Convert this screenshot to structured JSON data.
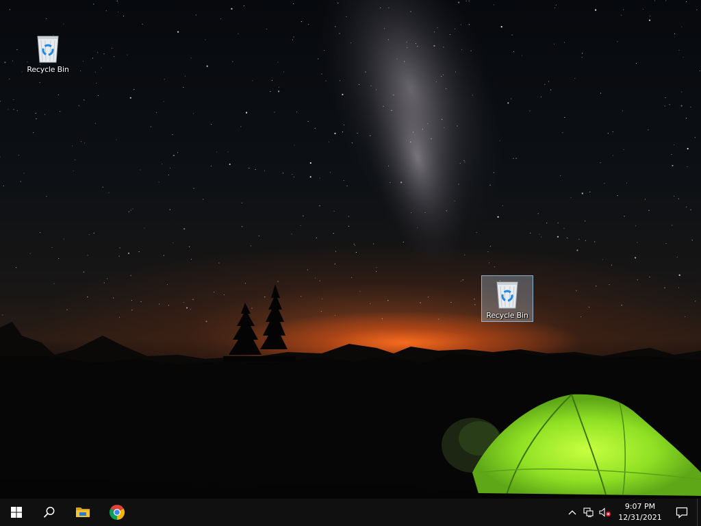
{
  "desktop": {
    "icons": [
      {
        "label": "Recycle Bin",
        "icon": "recycle-bin-icon",
        "selected": false
      },
      {
        "label": "Recycle Bin",
        "icon": "recycle-bin-icon",
        "selected": true
      }
    ]
  },
  "taskbar": {
    "start_icon": "windows-start-icon",
    "search_icon": "search-icon",
    "pinned": [
      {
        "name": "File Explorer",
        "icon": "file-explorer-icon"
      },
      {
        "name": "Google Chrome",
        "icon": "chrome-icon"
      }
    ],
    "tray": {
      "chevron_icon": "chevron-up-icon",
      "network_icon": "network-icon",
      "volume_icon": "volume-muted-icon",
      "time": "9:07 PM",
      "date": "12/31/2021",
      "notification_icon": "action-center-icon"
    }
  },
  "colors": {
    "taskbar_bg": "#101010",
    "horizon_glow": "#ff6e1e",
    "tent_green": "#8fe024",
    "selection_fill": "#cce8ff",
    "folder_yellow": "#f4c430",
    "chrome_red": "#db4437",
    "chrome_green": "#0f9d58",
    "chrome_yellow": "#f4b400",
    "chrome_blue": "#4285f4"
  }
}
